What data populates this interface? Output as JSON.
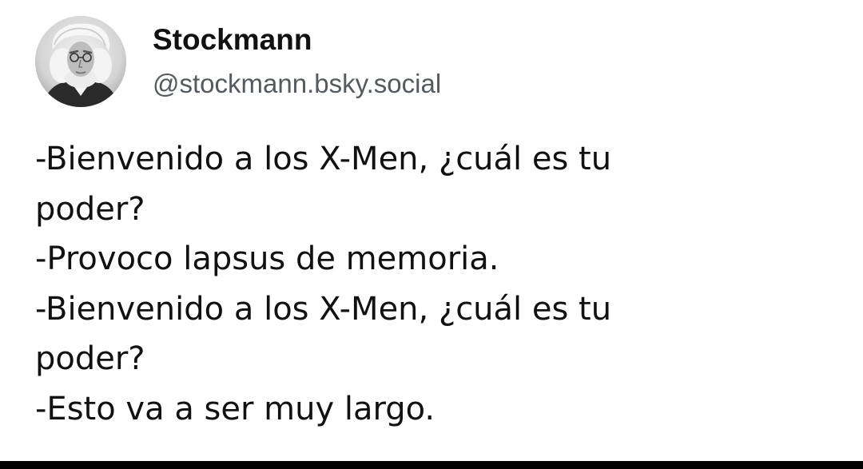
{
  "author": {
    "display_name": "Stockmann",
    "handle": "@stockmann.bsky.social",
    "avatar_icon": "portrait-photo"
  },
  "post": {
    "lines": [
      "-Bienvenido a los X-Men, ¿cuál es tu",
      "poder?",
      "-Provoco lapsus de memoria.",
      "-Bienvenido a los X-Men, ¿cuál es tu",
      "poder?",
      "-Esto va a ser muy largo."
    ]
  },
  "colors": {
    "background": "#ffffff",
    "text": "#111111",
    "handle": "#555a60",
    "bottom_bar": "#000000"
  }
}
